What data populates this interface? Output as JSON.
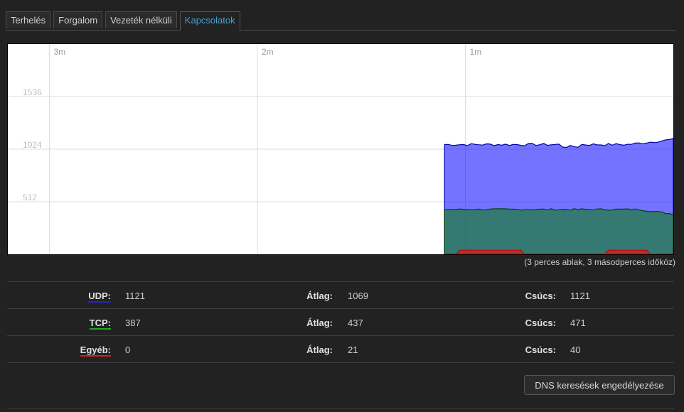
{
  "tabs": [
    {
      "label": "Terhelés",
      "active": false
    },
    {
      "label": "Forgalom",
      "active": false
    },
    {
      "label": "Vezeték nélküli",
      "active": false
    },
    {
      "label": "Kapcsolatok",
      "active": true
    }
  ],
  "chart_data": {
    "type": "area",
    "x_ticks": [
      "3m",
      "2m",
      "1m"
    ],
    "y_ticks": [
      "1536",
      "1024",
      "512"
    ],
    "ylim": [
      0,
      2048
    ],
    "time_window_minutes": 3.2,
    "active_from_minutes_ago": 1.1,
    "series": [
      {
        "name": "UDP",
        "color": "#0000ff",
        "current": 1121,
        "average": 1069,
        "peak": 1121
      },
      {
        "name": "TCP",
        "color": "#008000",
        "current": 387,
        "average": 437,
        "peak": 471
      },
      {
        "name": "Egyéb",
        "color": "#ff0000",
        "current": 0,
        "average": 21,
        "peak": 40
      }
    ],
    "caption": "(3 perces ablak, 3 másodperces időköz)"
  },
  "stats": [
    {
      "label": "UDP:",
      "current": "1121",
      "avg_label": "Átlag:",
      "avg": "1069",
      "peak_label": "Csúcs:",
      "peak": "1121"
    },
    {
      "label": "TCP:",
      "current": "387",
      "avg_label": "Átlag:",
      "avg": "437",
      "peak_label": "Csúcs:",
      "peak": "471"
    },
    {
      "label": "Egyéb:",
      "current": "0",
      "avg_label": "Átlag:",
      "avg": "21",
      "peak_label": "Csúcs:",
      "peak": "40"
    }
  ],
  "dns_button_label": "DNS keresések engedélyezése"
}
